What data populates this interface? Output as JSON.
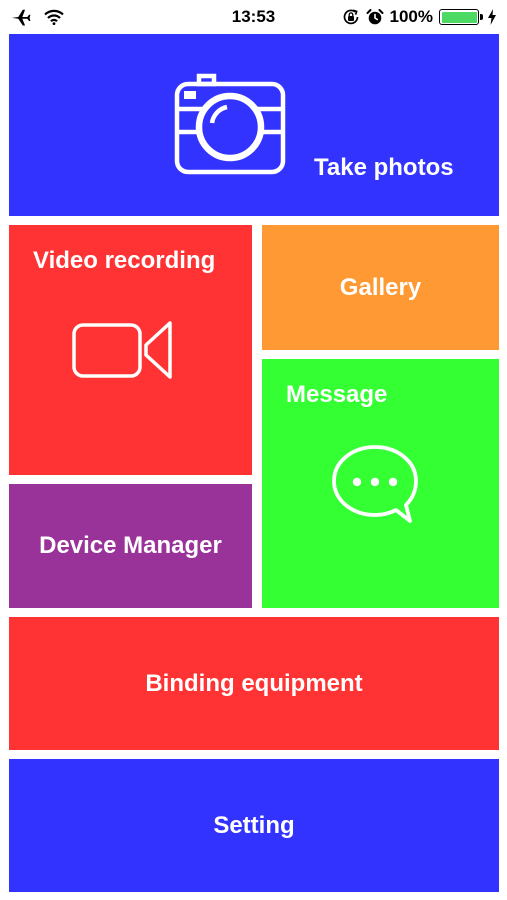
{
  "status_bar": {
    "time": "13:53",
    "battery_percent": "100%",
    "battery_level": 1.0,
    "icons": [
      "airplane-icon",
      "wifi-icon",
      "orientation-lock-icon",
      "alarm-icon",
      "battery-icon",
      "charging-icon"
    ]
  },
  "colors": {
    "blue": "#3333ff",
    "red": "#ff3333",
    "orange": "#ff9933",
    "green": "#33ff33",
    "purple": "#993399",
    "battery": "#4cd964"
  },
  "tiles": {
    "take_photos": {
      "label": "Take photos",
      "icon": "camera-icon"
    },
    "video_recording": {
      "label": "Video recording",
      "icon": "video-camera-icon"
    },
    "gallery": {
      "label": "Gallery"
    },
    "message": {
      "label": "Message",
      "icon": "chat-bubble-icon"
    },
    "device_manager": {
      "label": "Device Manager"
    },
    "binding_equipment": {
      "label": "Binding equipment"
    },
    "setting": {
      "label": "Setting"
    }
  }
}
